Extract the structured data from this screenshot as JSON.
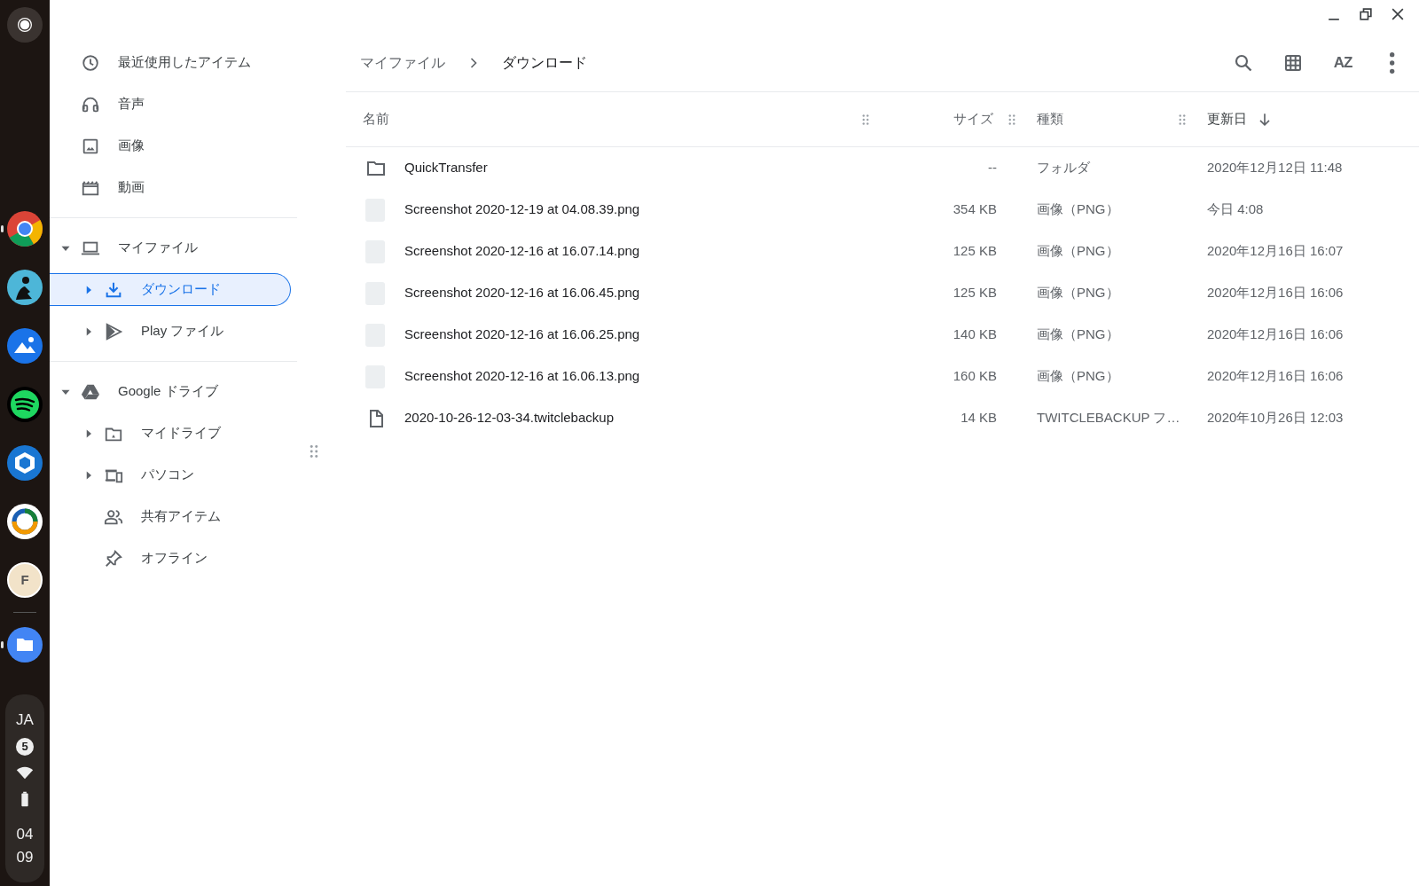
{
  "shelf": {
    "apps": [
      {
        "kind": "chrome",
        "running": true
      },
      {
        "kind": "reader",
        "running": false
      },
      {
        "kind": "gallery",
        "running": false
      },
      {
        "kind": "music",
        "running": false
      },
      {
        "kind": "cube",
        "running": false
      },
      {
        "kind": "ring",
        "running": false
      },
      {
        "kind": "letter-tile",
        "label": "F",
        "running": false
      },
      {
        "kind": "files",
        "running": true
      }
    ],
    "status": {
      "ime": "JA",
      "notifications": "5",
      "hour": "04",
      "minute": "09"
    }
  },
  "sidebar": {
    "sections": [
      {
        "items": [
          {
            "kind": "clock",
            "label": "最近使用したアイテム",
            "selected": false
          },
          {
            "kind": "headphones",
            "label": "音声",
            "selected": false
          },
          {
            "kind": "image",
            "label": "画像",
            "selected": false
          },
          {
            "kind": "film",
            "label": "動画",
            "selected": false
          }
        ]
      },
      {
        "items": [
          {
            "kind": "laptop",
            "label": "マイファイル",
            "selected": false,
            "expanded": true,
            "children": [
              {
                "kind": "download",
                "label": "ダウンロード",
                "selected": true,
                "expanded": false
              },
              {
                "kind": "play",
                "label": "Play ファイル",
                "selected": false,
                "expanded": false
              }
            ]
          }
        ]
      },
      {
        "items": [
          {
            "kind": "drive",
            "label": "Google ドライブ",
            "selected": false,
            "expanded": true,
            "children": [
              {
                "kind": "folder-drive",
                "label": "マイドライブ",
                "selected": false,
                "expanded": false
              },
              {
                "kind": "computer",
                "label": "パソコン",
                "selected": false,
                "expanded": false
              },
              {
                "kind": "people",
                "label": "共有アイテム",
                "selected": false
              },
              {
                "kind": "pin",
                "label": "オフライン",
                "selected": false
              }
            ]
          }
        ]
      }
    ]
  },
  "breadcrumb": [
    {
      "label": "マイファイル",
      "current": false
    },
    {
      "label": "ダウンロード",
      "current": true
    }
  ],
  "toolbar": [
    {
      "kind": "search"
    },
    {
      "kind": "grid"
    },
    {
      "kind": "sort",
      "label": "AZ"
    },
    {
      "kind": "more"
    }
  ],
  "table": {
    "columns": [
      {
        "label": "名前",
        "sorted": false
      },
      {
        "label": "サイズ",
        "sorted": false
      },
      {
        "label": "種類",
        "sorted": false
      },
      {
        "label": "更新日",
        "sorted": true
      }
    ],
    "rows": [
      {
        "kind": "folder",
        "name": "QuickTransfer",
        "size": "--",
        "type": "フォルダ",
        "modified": "2020年12月12日 11:48"
      },
      {
        "kind": "image",
        "name": "Screenshot 2020-12-19 at 04.08.39.png",
        "size": "354 KB",
        "type": "画像（PNG）",
        "modified": "今日 4:08"
      },
      {
        "kind": "image",
        "name": "Screenshot 2020-12-16 at 16.07.14.png",
        "size": "125 KB",
        "type": "画像（PNG）",
        "modified": "2020年12月16日 16:07"
      },
      {
        "kind": "image",
        "name": "Screenshot 2020-12-16 at 16.06.45.png",
        "size": "125 KB",
        "type": "画像（PNG）",
        "modified": "2020年12月16日 16:06"
      },
      {
        "kind": "image",
        "name": "Screenshot 2020-12-16 at 16.06.25.png",
        "size": "140 KB",
        "type": "画像（PNG）",
        "modified": "2020年12月16日 16:06"
      },
      {
        "kind": "image",
        "name": "Screenshot 2020-12-16 at 16.06.13.png",
        "size": "160 KB",
        "type": "画像（PNG）",
        "modified": "2020年12月16日 16:06"
      },
      {
        "kind": "file",
        "name": "2020-10-26-12-03-34.twitclebackup",
        "size": "14 KB",
        "type": "TWITCLEBACKUP フ…",
        "modified": "2020年10月26日 12:03"
      }
    ]
  }
}
